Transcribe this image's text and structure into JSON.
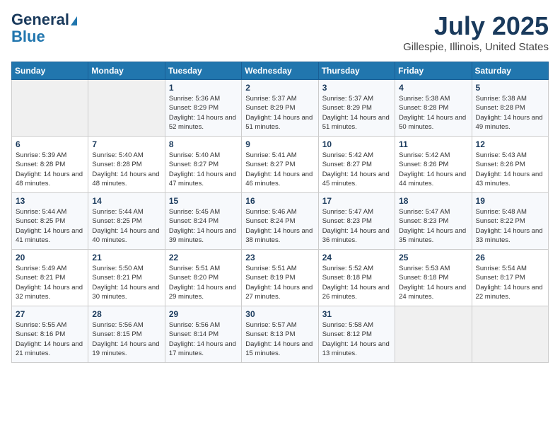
{
  "header": {
    "logo_line1": "General",
    "logo_line2": "Blue",
    "month": "July 2025",
    "location": "Gillespie, Illinois, United States"
  },
  "weekdays": [
    "Sunday",
    "Monday",
    "Tuesday",
    "Wednesday",
    "Thursday",
    "Friday",
    "Saturday"
  ],
  "weeks": [
    [
      {
        "day": "",
        "info": ""
      },
      {
        "day": "",
        "info": ""
      },
      {
        "day": "1",
        "info": "Sunrise: 5:36 AM\nSunset: 8:29 PM\nDaylight: 14 hours and 52 minutes."
      },
      {
        "day": "2",
        "info": "Sunrise: 5:37 AM\nSunset: 8:29 PM\nDaylight: 14 hours and 51 minutes."
      },
      {
        "day": "3",
        "info": "Sunrise: 5:37 AM\nSunset: 8:29 PM\nDaylight: 14 hours and 51 minutes."
      },
      {
        "day": "4",
        "info": "Sunrise: 5:38 AM\nSunset: 8:28 PM\nDaylight: 14 hours and 50 minutes."
      },
      {
        "day": "5",
        "info": "Sunrise: 5:38 AM\nSunset: 8:28 PM\nDaylight: 14 hours and 49 minutes."
      }
    ],
    [
      {
        "day": "6",
        "info": "Sunrise: 5:39 AM\nSunset: 8:28 PM\nDaylight: 14 hours and 48 minutes."
      },
      {
        "day": "7",
        "info": "Sunrise: 5:40 AM\nSunset: 8:28 PM\nDaylight: 14 hours and 48 minutes."
      },
      {
        "day": "8",
        "info": "Sunrise: 5:40 AM\nSunset: 8:27 PM\nDaylight: 14 hours and 47 minutes."
      },
      {
        "day": "9",
        "info": "Sunrise: 5:41 AM\nSunset: 8:27 PM\nDaylight: 14 hours and 46 minutes."
      },
      {
        "day": "10",
        "info": "Sunrise: 5:42 AM\nSunset: 8:27 PM\nDaylight: 14 hours and 45 minutes."
      },
      {
        "day": "11",
        "info": "Sunrise: 5:42 AM\nSunset: 8:26 PM\nDaylight: 14 hours and 44 minutes."
      },
      {
        "day": "12",
        "info": "Sunrise: 5:43 AM\nSunset: 8:26 PM\nDaylight: 14 hours and 43 minutes."
      }
    ],
    [
      {
        "day": "13",
        "info": "Sunrise: 5:44 AM\nSunset: 8:25 PM\nDaylight: 14 hours and 41 minutes."
      },
      {
        "day": "14",
        "info": "Sunrise: 5:44 AM\nSunset: 8:25 PM\nDaylight: 14 hours and 40 minutes."
      },
      {
        "day": "15",
        "info": "Sunrise: 5:45 AM\nSunset: 8:24 PM\nDaylight: 14 hours and 39 minutes."
      },
      {
        "day": "16",
        "info": "Sunrise: 5:46 AM\nSunset: 8:24 PM\nDaylight: 14 hours and 38 minutes."
      },
      {
        "day": "17",
        "info": "Sunrise: 5:47 AM\nSunset: 8:23 PM\nDaylight: 14 hours and 36 minutes."
      },
      {
        "day": "18",
        "info": "Sunrise: 5:47 AM\nSunset: 8:23 PM\nDaylight: 14 hours and 35 minutes."
      },
      {
        "day": "19",
        "info": "Sunrise: 5:48 AM\nSunset: 8:22 PM\nDaylight: 14 hours and 33 minutes."
      }
    ],
    [
      {
        "day": "20",
        "info": "Sunrise: 5:49 AM\nSunset: 8:21 PM\nDaylight: 14 hours and 32 minutes."
      },
      {
        "day": "21",
        "info": "Sunrise: 5:50 AM\nSunset: 8:21 PM\nDaylight: 14 hours and 30 minutes."
      },
      {
        "day": "22",
        "info": "Sunrise: 5:51 AM\nSunset: 8:20 PM\nDaylight: 14 hours and 29 minutes."
      },
      {
        "day": "23",
        "info": "Sunrise: 5:51 AM\nSunset: 8:19 PM\nDaylight: 14 hours and 27 minutes."
      },
      {
        "day": "24",
        "info": "Sunrise: 5:52 AM\nSunset: 8:18 PM\nDaylight: 14 hours and 26 minutes."
      },
      {
        "day": "25",
        "info": "Sunrise: 5:53 AM\nSunset: 8:18 PM\nDaylight: 14 hours and 24 minutes."
      },
      {
        "day": "26",
        "info": "Sunrise: 5:54 AM\nSunset: 8:17 PM\nDaylight: 14 hours and 22 minutes."
      }
    ],
    [
      {
        "day": "27",
        "info": "Sunrise: 5:55 AM\nSunset: 8:16 PM\nDaylight: 14 hours and 21 minutes."
      },
      {
        "day": "28",
        "info": "Sunrise: 5:56 AM\nSunset: 8:15 PM\nDaylight: 14 hours and 19 minutes."
      },
      {
        "day": "29",
        "info": "Sunrise: 5:56 AM\nSunset: 8:14 PM\nDaylight: 14 hours and 17 minutes."
      },
      {
        "day": "30",
        "info": "Sunrise: 5:57 AM\nSunset: 8:13 PM\nDaylight: 14 hours and 15 minutes."
      },
      {
        "day": "31",
        "info": "Sunrise: 5:58 AM\nSunset: 8:12 PM\nDaylight: 14 hours and 13 minutes."
      },
      {
        "day": "",
        "info": ""
      },
      {
        "day": "",
        "info": ""
      }
    ]
  ]
}
